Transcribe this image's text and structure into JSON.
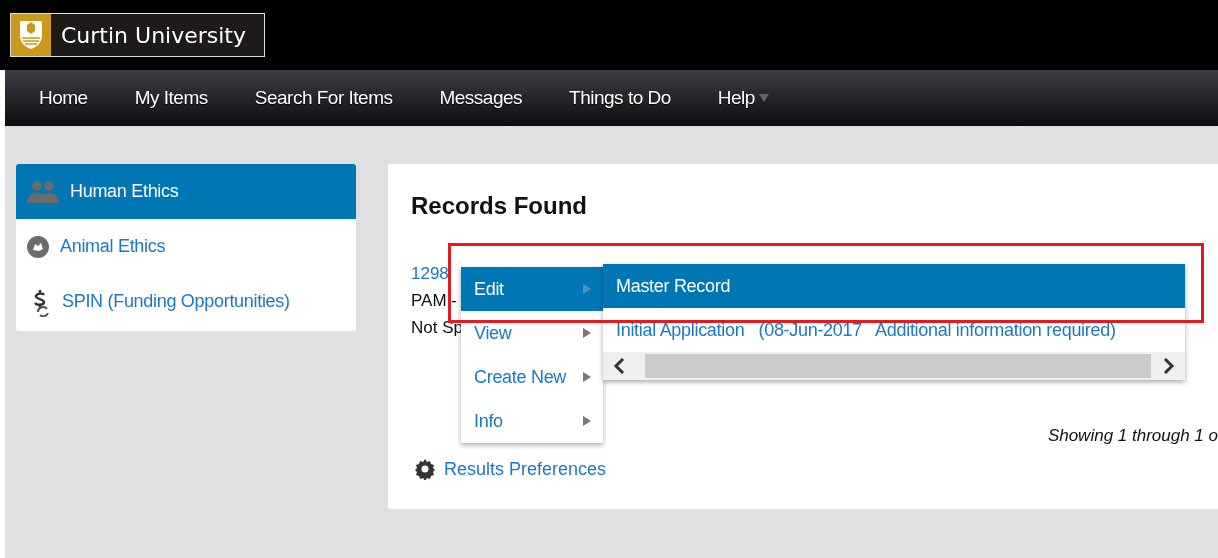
{
  "header": {
    "logo_text": "Curtin University"
  },
  "nav": [
    {
      "label": "Home",
      "has_dropdown": false
    },
    {
      "label": "My Items",
      "has_dropdown": false
    },
    {
      "label": "Search For Items",
      "has_dropdown": false
    },
    {
      "label": "Messages",
      "has_dropdown": false
    },
    {
      "label": "Things to Do",
      "has_dropdown": false
    },
    {
      "label": "Help",
      "has_dropdown": true
    }
  ],
  "sidebar": {
    "items": [
      {
        "label": "Human Ethics",
        "selected": true
      },
      {
        "label": "Animal Ethics",
        "selected": false
      },
      {
        "label": "SPIN (Funding Opportunities)",
        "selected": false
      }
    ]
  },
  "records": {
    "title": "Records Found",
    "record_lines": [
      {
        "text": "1298",
        "kind": "link"
      },
      {
        "text": "PAM -",
        "kind": "plain"
      },
      {
        "text": "Not Sp",
        "kind": "plain"
      }
    ],
    "showing": "Showing 1 through 1 o",
    "preferences_link": "Results Preferences"
  },
  "context_menu": {
    "items": [
      {
        "label": "Edit",
        "selected": true
      },
      {
        "label": "View",
        "selected": false
      },
      {
        "label": "Create New",
        "selected": false
      },
      {
        "label": "Info",
        "selected": false
      }
    ]
  },
  "submenu": {
    "items": [
      {
        "label": "Master Record",
        "selected": true
      },
      {
        "label": "Initial Application   (08-Jun-2017   Additional information required)",
        "selected": false
      }
    ]
  },
  "annotation": {
    "highlight": true
  }
}
